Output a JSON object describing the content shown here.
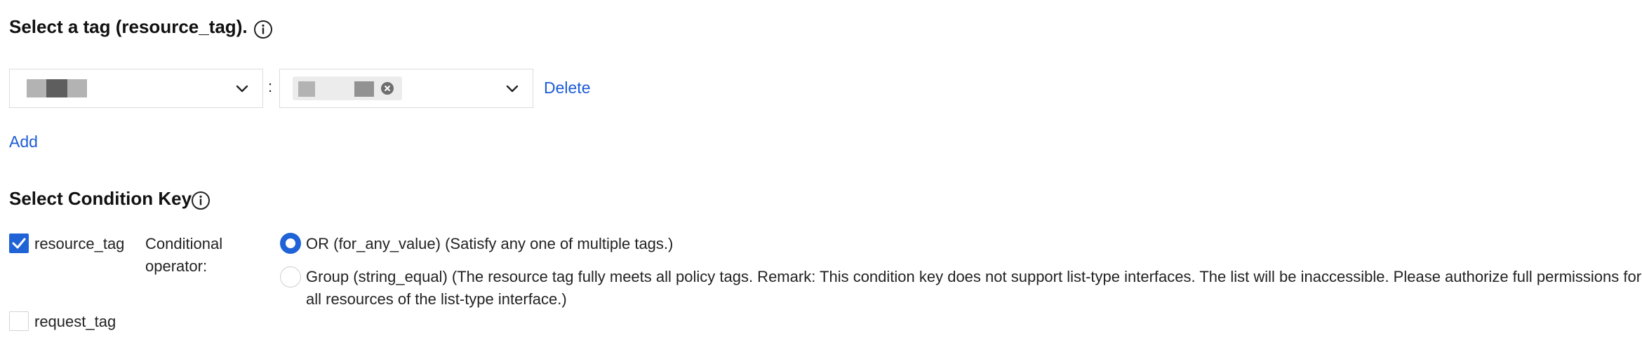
{
  "section1": {
    "title": "Select a tag (resource_tag).",
    "separator": ":",
    "delete_label": "Delete",
    "add_label": "Add"
  },
  "section2": {
    "title": "Select Condition Key",
    "keys": [
      {
        "label": "resource_tag",
        "checked": true
      },
      {
        "label": "request_tag",
        "checked": false
      }
    ],
    "operator_label_line1": "Conditional",
    "operator_label_line2": "operator:",
    "options": [
      {
        "label": "OR (for_any_value) (Satisfy any one of multiple tags.)",
        "selected": true
      },
      {
        "label_line1": "Group (string_equal) (The resource tag fully meets all policy tags. Remark: This condition key does not support list-type interfaces. The list will be inaccessible. Please authorize full permissions for",
        "label_line2": "all resources of the list-type interface.)",
        "selected": false
      }
    ]
  },
  "colors": {
    "accent": "#1f63d7",
    "link": "#1c5cd6",
    "border": "#dcdcdc"
  },
  "icons": [
    "info-icon",
    "chevron-down-icon",
    "close-circle-icon",
    "check-icon"
  ]
}
